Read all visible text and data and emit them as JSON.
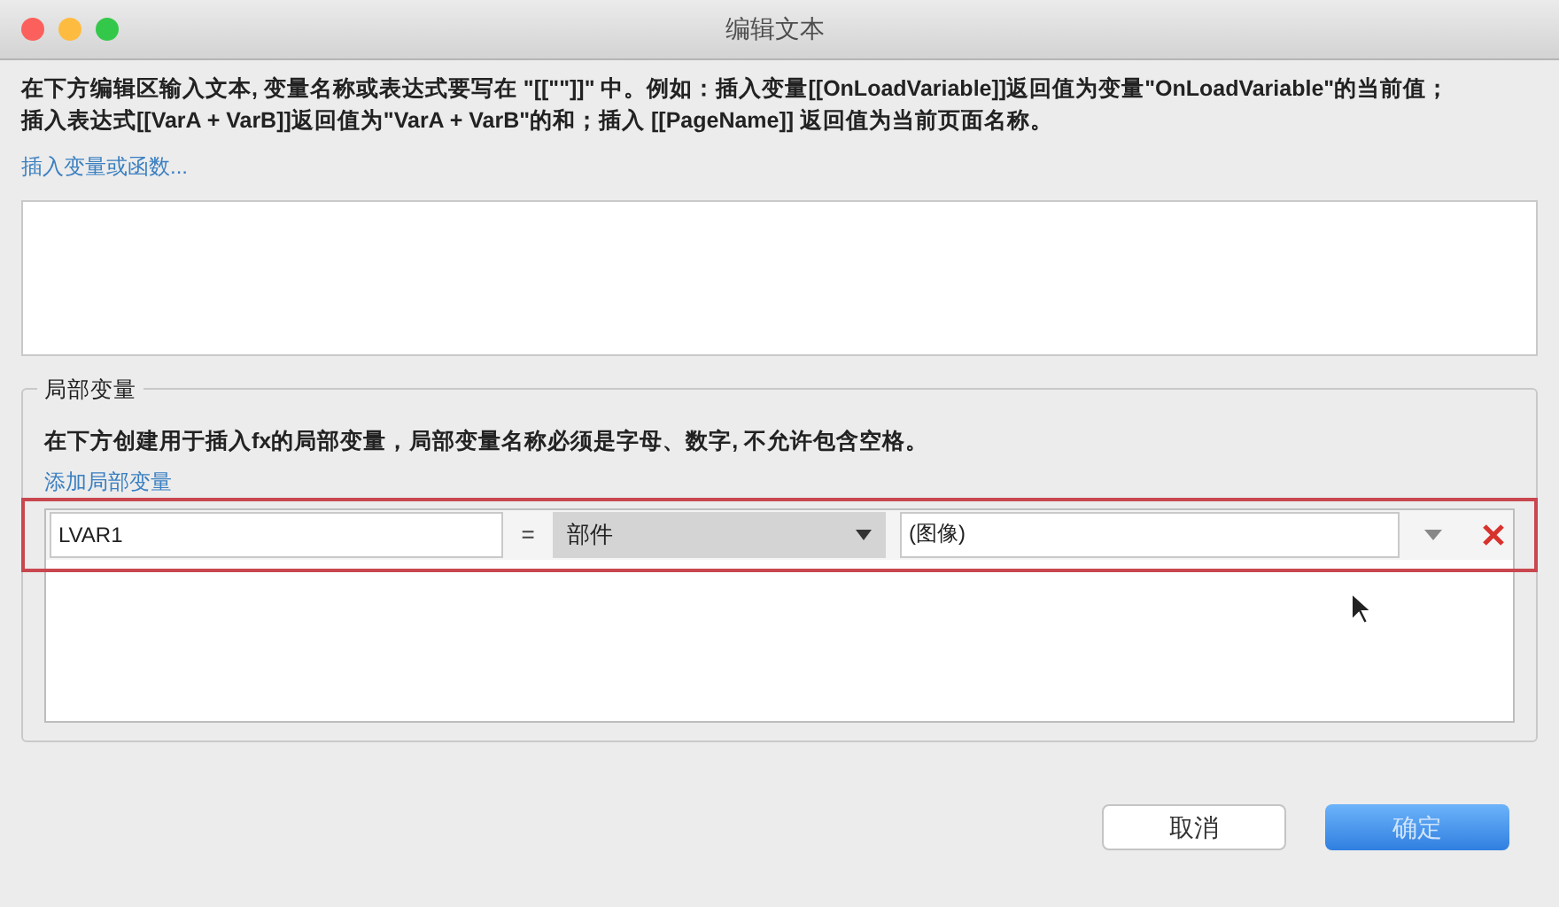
{
  "window": {
    "title": "编辑文本"
  },
  "description": "在下方编辑区输入文本, 变量名称或表达式要写在 \"[[\"\"]]\" 中。例如：插入变量[[OnLoadVariable]]返回值为变量\"OnLoadVariable\"的当前值；插入表达式[[VarA + VarB]]返回值为\"VarA + VarB\"的和；插入 [[PageName]] 返回值为当前页面名称。",
  "insert_link": "插入变量或函数...",
  "local_variables": {
    "legend": "局部变量",
    "description": "在下方创建用于插入fx的局部变量，局部变量名称必须是字母、数字, 不允许包含空格。",
    "add_link": "添加局部变量",
    "rows": [
      {
        "name": "LVAR1",
        "equals": "=",
        "type": "部件",
        "target": "(图像)",
        "highlighted": true
      }
    ]
  },
  "buttons": [
    {
      "label": "取消",
      "primary": false
    },
    {
      "label": "确定",
      "primary": true
    }
  ]
}
